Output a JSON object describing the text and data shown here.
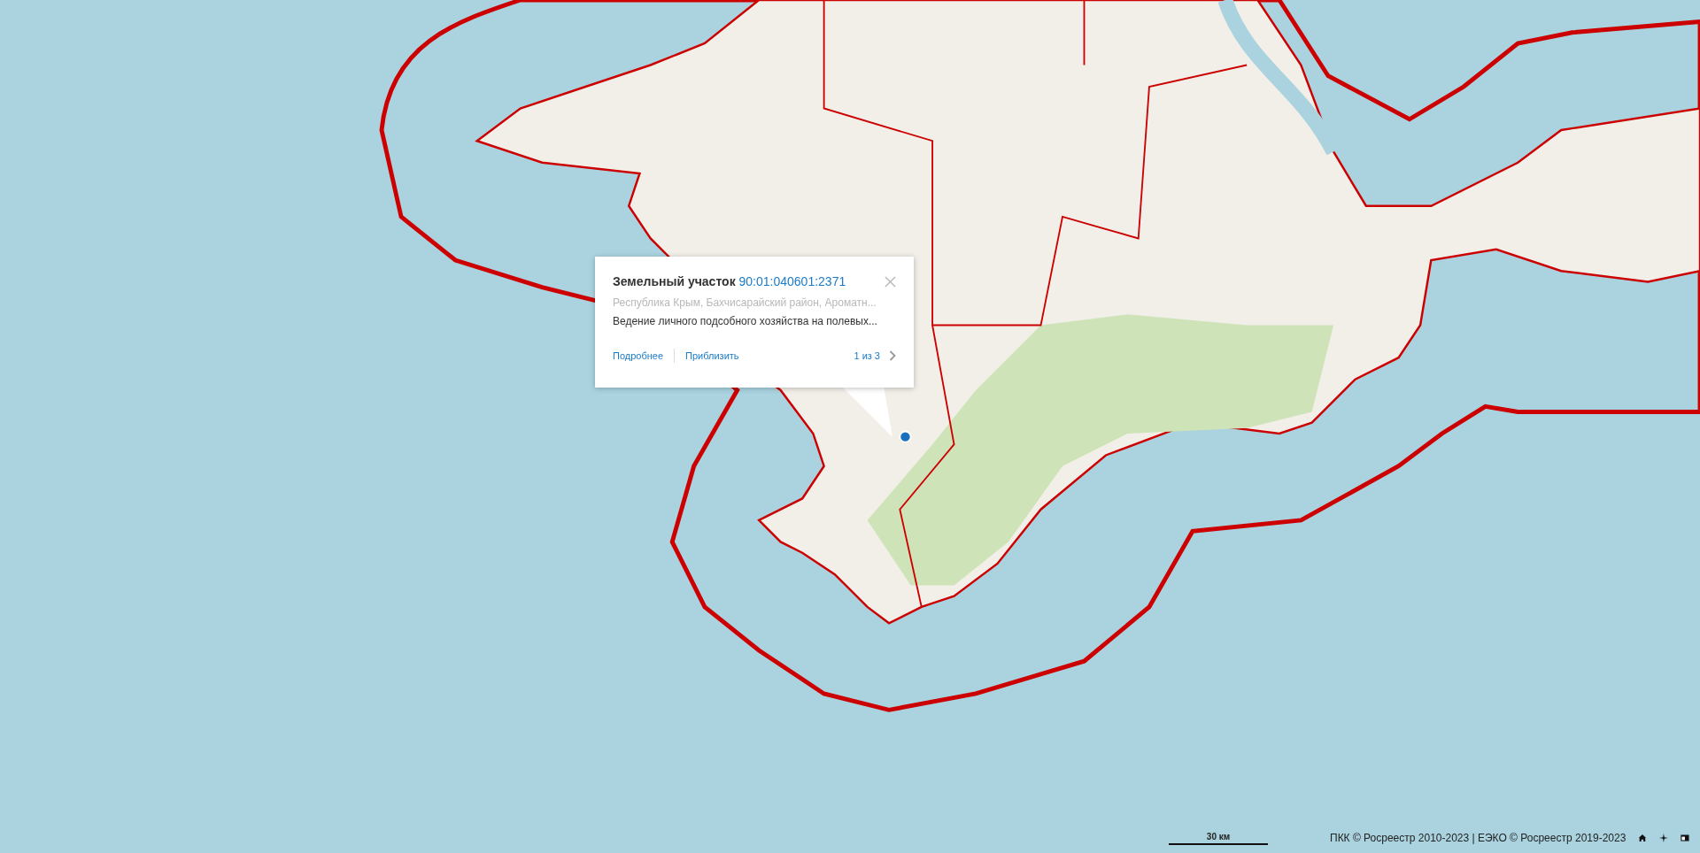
{
  "popup": {
    "title": "Земельный участок",
    "cadastral_number": "90:01:040601:2371",
    "address": "Республика Крым, Бахчисарайский район, Ароматн...",
    "description": "Ведение личного подсобного хозяйства на полевых...",
    "actions": [
      "Подробнее",
      "Приблизить"
    ],
    "pager": "1 из 3"
  },
  "scale": {
    "label": "30 км"
  },
  "attribution": "ПКК © Росреестр 2010-2023 | ЕЭКО © Росреестр 2019-2023"
}
